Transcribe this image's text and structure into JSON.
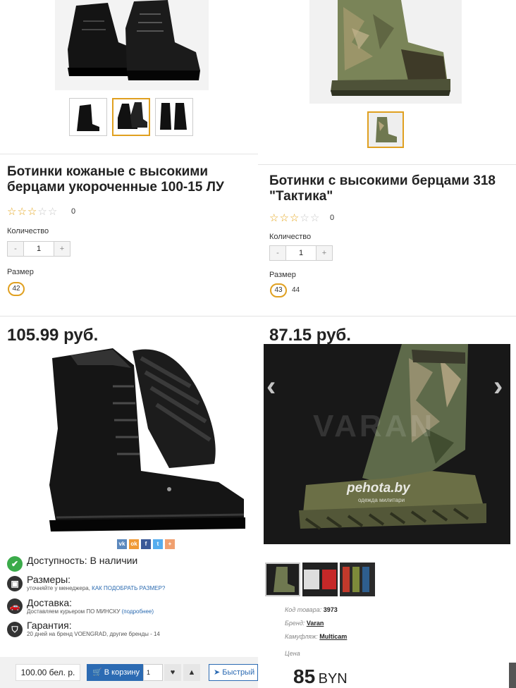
{
  "left_card": {
    "title": "Ботинки кожаные с высокими берцами укороченные 100-15 ЛУ",
    "rating": 0,
    "rating_count": "0",
    "quantity_label": "Количество",
    "quantity_minus": "-",
    "quantity_value": "1",
    "quantity_plus": "+",
    "size_label": "Размер",
    "sizes": [
      "42"
    ],
    "price": "105.99 руб."
  },
  "right_card": {
    "title": "Ботинки с высокими берцами 318 \"Тактика\"",
    "rating": 0,
    "rating_count": "0",
    "quantity_label": "Количество",
    "quantity_minus": "-",
    "quantity_value": "1",
    "quantity_plus": "+",
    "size_label": "Размер",
    "sizes": [
      "43",
      "44"
    ],
    "price": "87.15 руб."
  },
  "social": {
    "icons": [
      "vk-icon",
      "ok-icon",
      "facebook-icon",
      "twitter-icon",
      "plus-icon"
    ],
    "letters": [
      "vk",
      "ok",
      "f",
      "t",
      "+"
    ],
    "colors": [
      "#5b88bd",
      "#f09a36",
      "#3b5998",
      "#55acee",
      "#f0a070"
    ]
  },
  "info": {
    "availability": "Доступность: В наличии",
    "sizes_title": "Размеры:",
    "sizes_sub": "уточняйте у менеджера,",
    "sizes_link": "КАК ПОДОБРАТЬ РАЗМЕР?",
    "delivery_title": "Доставка:",
    "delivery_sub": "Доставляем курьером ПО МИНСКУ",
    "delivery_link": "(подробнее)",
    "warranty_title": "Гарантия:",
    "warranty_sub": "20 дней на бренд VOENGRAD, другие бренды - 14"
  },
  "buy_bar": {
    "price": "100.00 бел. р.",
    "cart_label": "В корзину",
    "cart_qty": "1",
    "quick_label": "Быстрый"
  },
  "product_detail": {
    "watermark": "VARAN",
    "overlay_brand": "pehota.by",
    "overlay_sub": "одежда милитари",
    "code_label": "Код товара:",
    "code_value": "3973",
    "brand_label": "Бренд:",
    "brand_value": "Varan",
    "camo_label": "Камуфляж:",
    "camo_value": "Multicam",
    "price_label": "Цена",
    "price_value": "85",
    "price_currency": "BYN"
  },
  "colors": {
    "accent_gold": "#e0a020",
    "star": "#e4a51c",
    "button_blue": "#2c6bb3",
    "check_green": "#3bab4a"
  }
}
